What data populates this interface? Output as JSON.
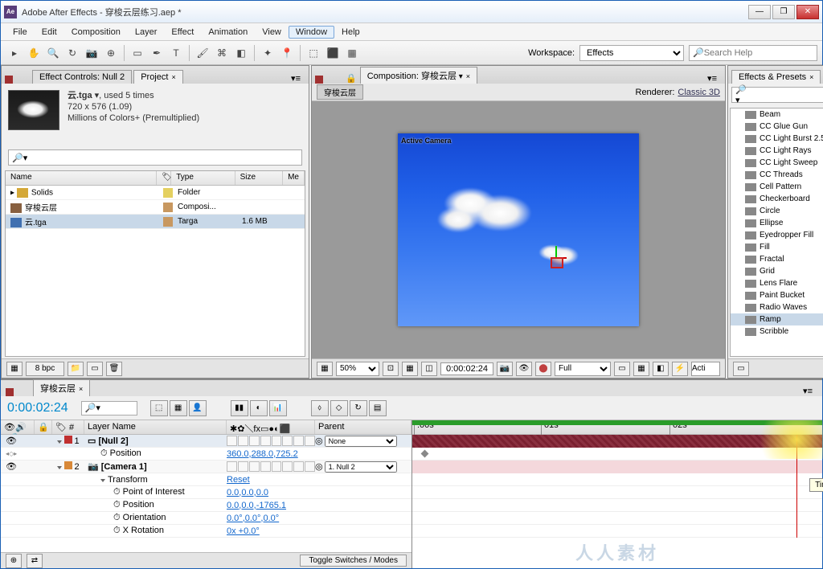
{
  "titlebar": {
    "app": "Adobe After Effects",
    "file": "穿梭云层练习.aep *"
  },
  "menu": [
    "File",
    "Edit",
    "Composition",
    "Layer",
    "Effect",
    "Animation",
    "View",
    "Window",
    "Help"
  ],
  "menu_active": "Window",
  "workspace": {
    "label": "Workspace:",
    "value": "Effects"
  },
  "search_help": {
    "placeholder": "Search Help"
  },
  "project": {
    "tab_effect": "Effect Controls: Null 2",
    "tab_project": "Project",
    "meta_name": "云.tga",
    "meta_used": ", used 5 times",
    "meta_dim": "720 x 576 (1.09)",
    "meta_color": "Millions of Colors+ (Premultiplied)",
    "cols": {
      "name": "Name",
      "type": "Type",
      "size": "Size",
      "me": "Me"
    },
    "rows": [
      {
        "name": "Solids",
        "type": "Folder",
        "size": "",
        "icon": "folder",
        "swatch": "#e4d060"
      },
      {
        "name": "穿梭云层",
        "type": "Composi...",
        "size": "",
        "icon": "comp",
        "swatch": "#c89860"
      },
      {
        "name": "云.tga",
        "type": "Targa",
        "size": "1.6 MB",
        "icon": "tga",
        "swatch": "#c89860"
      }
    ],
    "bpc": "8 bpc"
  },
  "composition": {
    "tab": "Composition: 穿梭云层",
    "name": "穿梭云层",
    "renderer_label": "Renderer:",
    "renderer_value": "Classic 3D",
    "active_cam": "Active Camera",
    "zoom": "50%",
    "timecode": "0:00:02:24",
    "res": "Full",
    "active_text": "Acti"
  },
  "effects": {
    "title": "Effects & Presets",
    "items": [
      "Beam",
      "CC Glue Gun",
      "CC Light Burst 2.5",
      "CC Light Rays",
      "CC Light Sweep",
      "CC Threads",
      "Cell Pattern",
      "Checkerboard",
      "Circle",
      "Ellipse",
      "Eyedropper Fill",
      "Fill",
      "Fractal",
      "Grid",
      "Lens Flare",
      "Paint Bucket",
      "Radio Waves",
      "Ramp",
      "Scribble"
    ],
    "selected": "Ramp"
  },
  "timeline": {
    "tab": "穿梭云层",
    "timecode": "0:00:02:24",
    "ruler": [
      ":00s",
      "01s",
      "02s"
    ],
    "cols": {
      "layer_name": "Layer Name",
      "parent": "Parent"
    },
    "layers": [
      {
        "idx": "1",
        "name": "Null 2",
        "color": "#c03030",
        "parent": "None",
        "props": [
          {
            "name": "Position",
            "value": "360.0,288.0,725.2",
            "kf": true
          }
        ]
      },
      {
        "idx": "2",
        "name": "Camera 1",
        "color": "#d88838",
        "parent": "1. Null 2",
        "props": [
          {
            "name": "Transform",
            "value": "Reset"
          },
          {
            "name": "Point of Interest",
            "value": "0.0,0.0,0.0"
          },
          {
            "name": "Position",
            "value": "0.0,0.0,-1765.1"
          },
          {
            "name": "Orientation",
            "value": "0.0°,0.0°,0.0°"
          },
          {
            "name": "X Rotation",
            "value": "0x +0.0°"
          }
        ]
      }
    ],
    "toggle": "Toggle Switches / Modes",
    "tooltip": "Time"
  },
  "watermark": "人人素材"
}
